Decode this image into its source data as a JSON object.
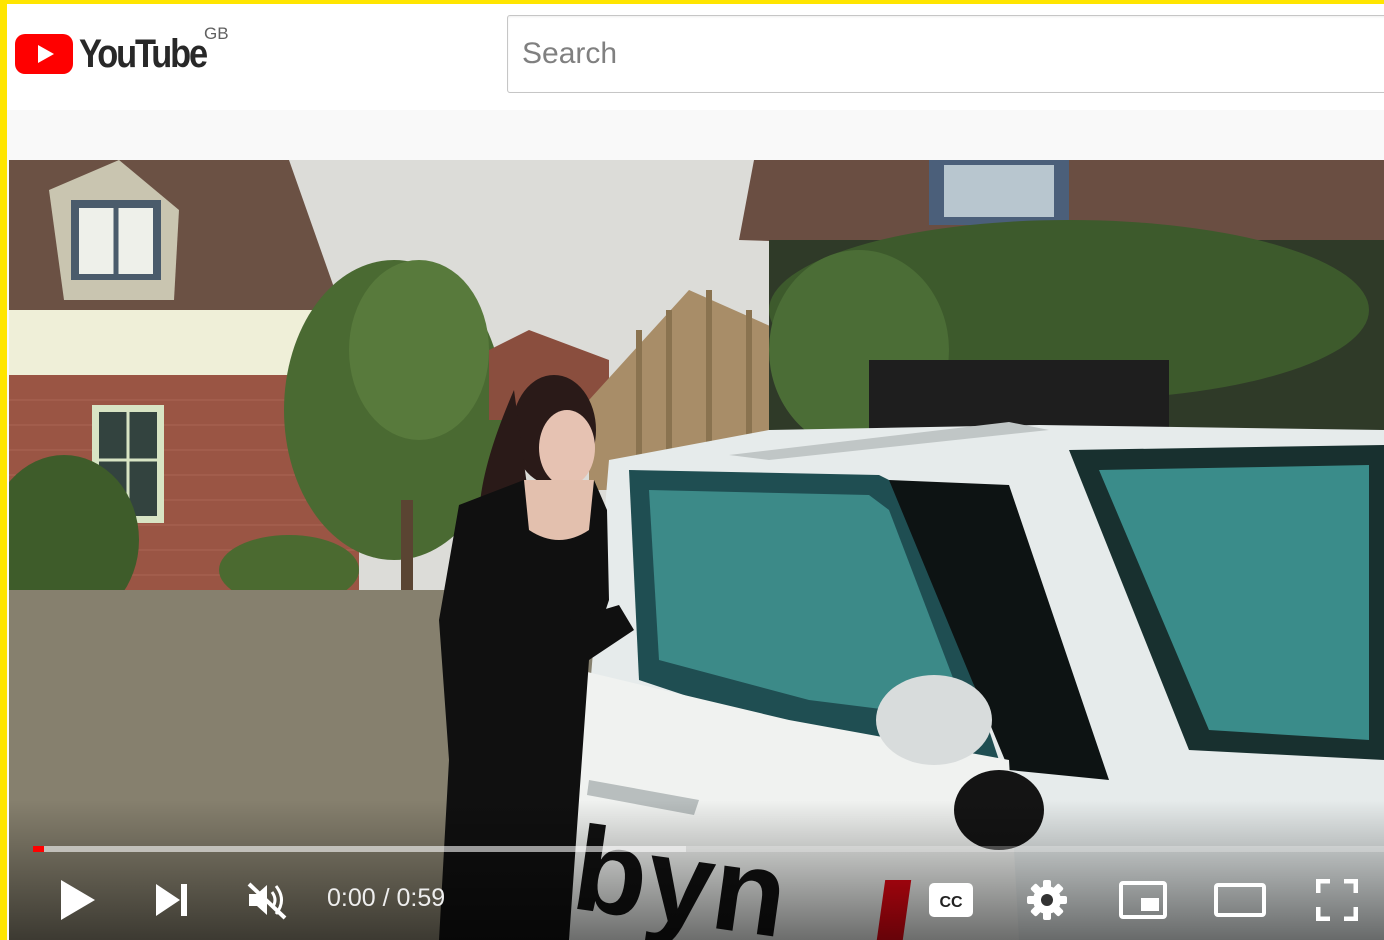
{
  "header": {
    "logo_text": "YouTube",
    "country_code": "GB",
    "search_placeholder": "Search"
  },
  "player": {
    "time_current": "0:00",
    "time_separator": " / ",
    "time_total": "0:59",
    "progress_played_fraction": 0.008,
    "progress_loaded_fraction": 0.48,
    "muted": true,
    "controls": [
      {
        "name": "play-button",
        "icon": "play-icon"
      },
      {
        "name": "next-button",
        "icon": "skip-next-icon"
      },
      {
        "name": "mute-button",
        "icon": "volume-muted-icon"
      },
      {
        "name": "subtitles-button",
        "icon": "cc-icon"
      },
      {
        "name": "settings-button",
        "icon": "gear-icon"
      },
      {
        "name": "miniplayer-button",
        "icon": "miniplayer-icon"
      },
      {
        "name": "theater-mode-button",
        "icon": "theater-icon"
      },
      {
        "name": "fullscreen-button",
        "icon": "fullscreen-icon"
      }
    ]
  },
  "colors": {
    "frame": "#ffe500",
    "youtube_red": "#ff0000",
    "header_bg": "#ffffff",
    "page_bg": "#f9f9f9"
  }
}
